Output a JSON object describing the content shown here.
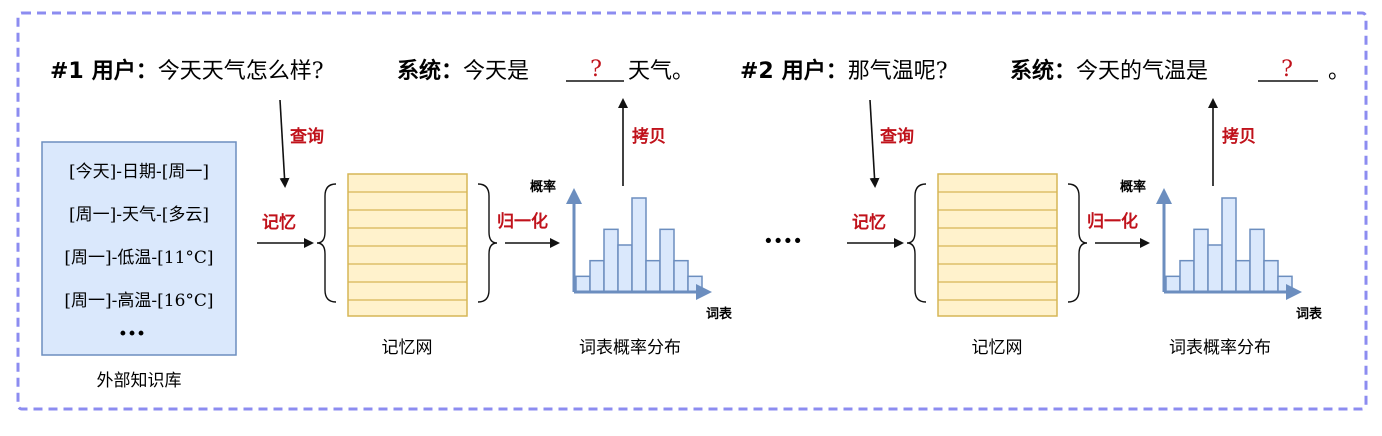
{
  "dialog": {
    "turn1": {
      "id": "#1",
      "user_label": "用户：",
      "user_text": "今天天气怎么样?",
      "sys_label": "系统：",
      "sys_pre": "今天是",
      "blank": "?",
      "sys_post": "天气。"
    },
    "turn2": {
      "id": "#2",
      "user_label": "用户：",
      "user_text": "那气温呢?",
      "sys_label": "系统：",
      "sys_pre": "今天的气温是",
      "blank": "?",
      "sys_post": "。"
    }
  },
  "knowledge_base": {
    "items": [
      "[今天]-日期-[周一]",
      "[周一]-天气-[多云]",
      "[周一]-低温-[11°C]",
      "[周一]-高温-[16°C]"
    ],
    "ellipsis": "···",
    "caption": "外部知识库"
  },
  "labels": {
    "query": "查询",
    "memory": "记忆",
    "normalize": "归一化",
    "copy": "拷贝",
    "memory_net": "记忆网",
    "distribution": "词表概率分布",
    "prob_axis": "概率",
    "vocab_axis": "词表",
    "between": "····"
  },
  "colors": {
    "frame": "#8c8cf0",
    "kb_fill": "#dae8fc",
    "kb_stroke": "#6c8ebf",
    "mem_fill": "#fff2cc",
    "mem_stroke": "#d6b656",
    "bar_fill": "#dae8fc",
    "bar_stroke": "#6c8ebf",
    "axis": "#6c8ebf",
    "red": "#c0121b"
  },
  "histogram": {
    "values": [
      1,
      2,
      4,
      3,
      6,
      2,
      4,
      2,
      1
    ]
  }
}
